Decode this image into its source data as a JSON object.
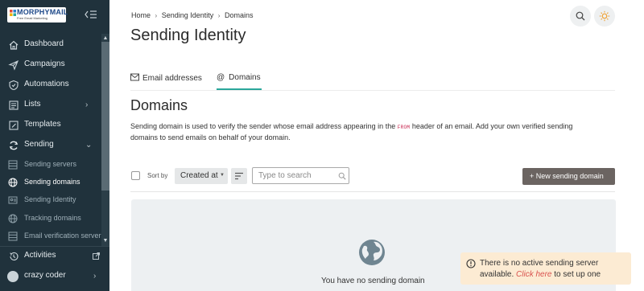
{
  "brand": {
    "name": "MORPHYMAIL",
    "tagline": "Free Email Marketing"
  },
  "sidebar": {
    "items": [
      {
        "label": "Dashboard",
        "icon": "home-icon"
      },
      {
        "label": "Campaigns",
        "icon": "send-icon"
      },
      {
        "label": "Automations",
        "icon": "automation-icon"
      },
      {
        "label": "Lists",
        "icon": "list-icon"
      },
      {
        "label": "Templates",
        "icon": "template-icon"
      },
      {
        "label": "Sending",
        "icon": "sending-icon"
      }
    ],
    "sending_sub": [
      {
        "label": "Sending servers",
        "icon": "server-icon"
      },
      {
        "label": "Sending domains",
        "icon": "globe-icon",
        "active": true
      },
      {
        "label": "Sending Identity",
        "icon": "identity-icon"
      },
      {
        "label": "Tracking domains",
        "icon": "globe-icon"
      },
      {
        "label": "Email verification servers",
        "icon": "server-icon"
      }
    ],
    "activities": "Activities",
    "user": "crazy coder"
  },
  "breadcrumb": [
    "Home",
    "Sending Identity",
    "Domains"
  ],
  "page_title": "Sending Identity",
  "tabs": [
    {
      "label": "Email addresses",
      "icon": "mail-icon"
    },
    {
      "label": "Domains",
      "icon": "at-icon",
      "active": true
    }
  ],
  "section": {
    "title": "Domains",
    "desc_before": "Sending domain is used to verify the sender whose email address appearing in the ",
    "desc_code": "FROM",
    "desc_after": " header of an email. Add your own verified sending domains to send emails on behalf of your domain."
  },
  "toolbar": {
    "sort_by": "Sort by",
    "sort_value": "Created at",
    "search_placeholder": "Type to search",
    "new_button": "+ New sending domain"
  },
  "empty": {
    "text": "You have no sending domain"
  },
  "toast": {
    "line1": "There is no active sending server",
    "line2_before": "available. ",
    "line2_link": "Click here",
    "line2_after": " to set up one"
  },
  "colors": {
    "sidebar_bg": "#20323c",
    "accent": "#2aa79b",
    "button_dark": "#6b6461",
    "toast_bg": "#fcebd3",
    "link": "#d9534f"
  }
}
